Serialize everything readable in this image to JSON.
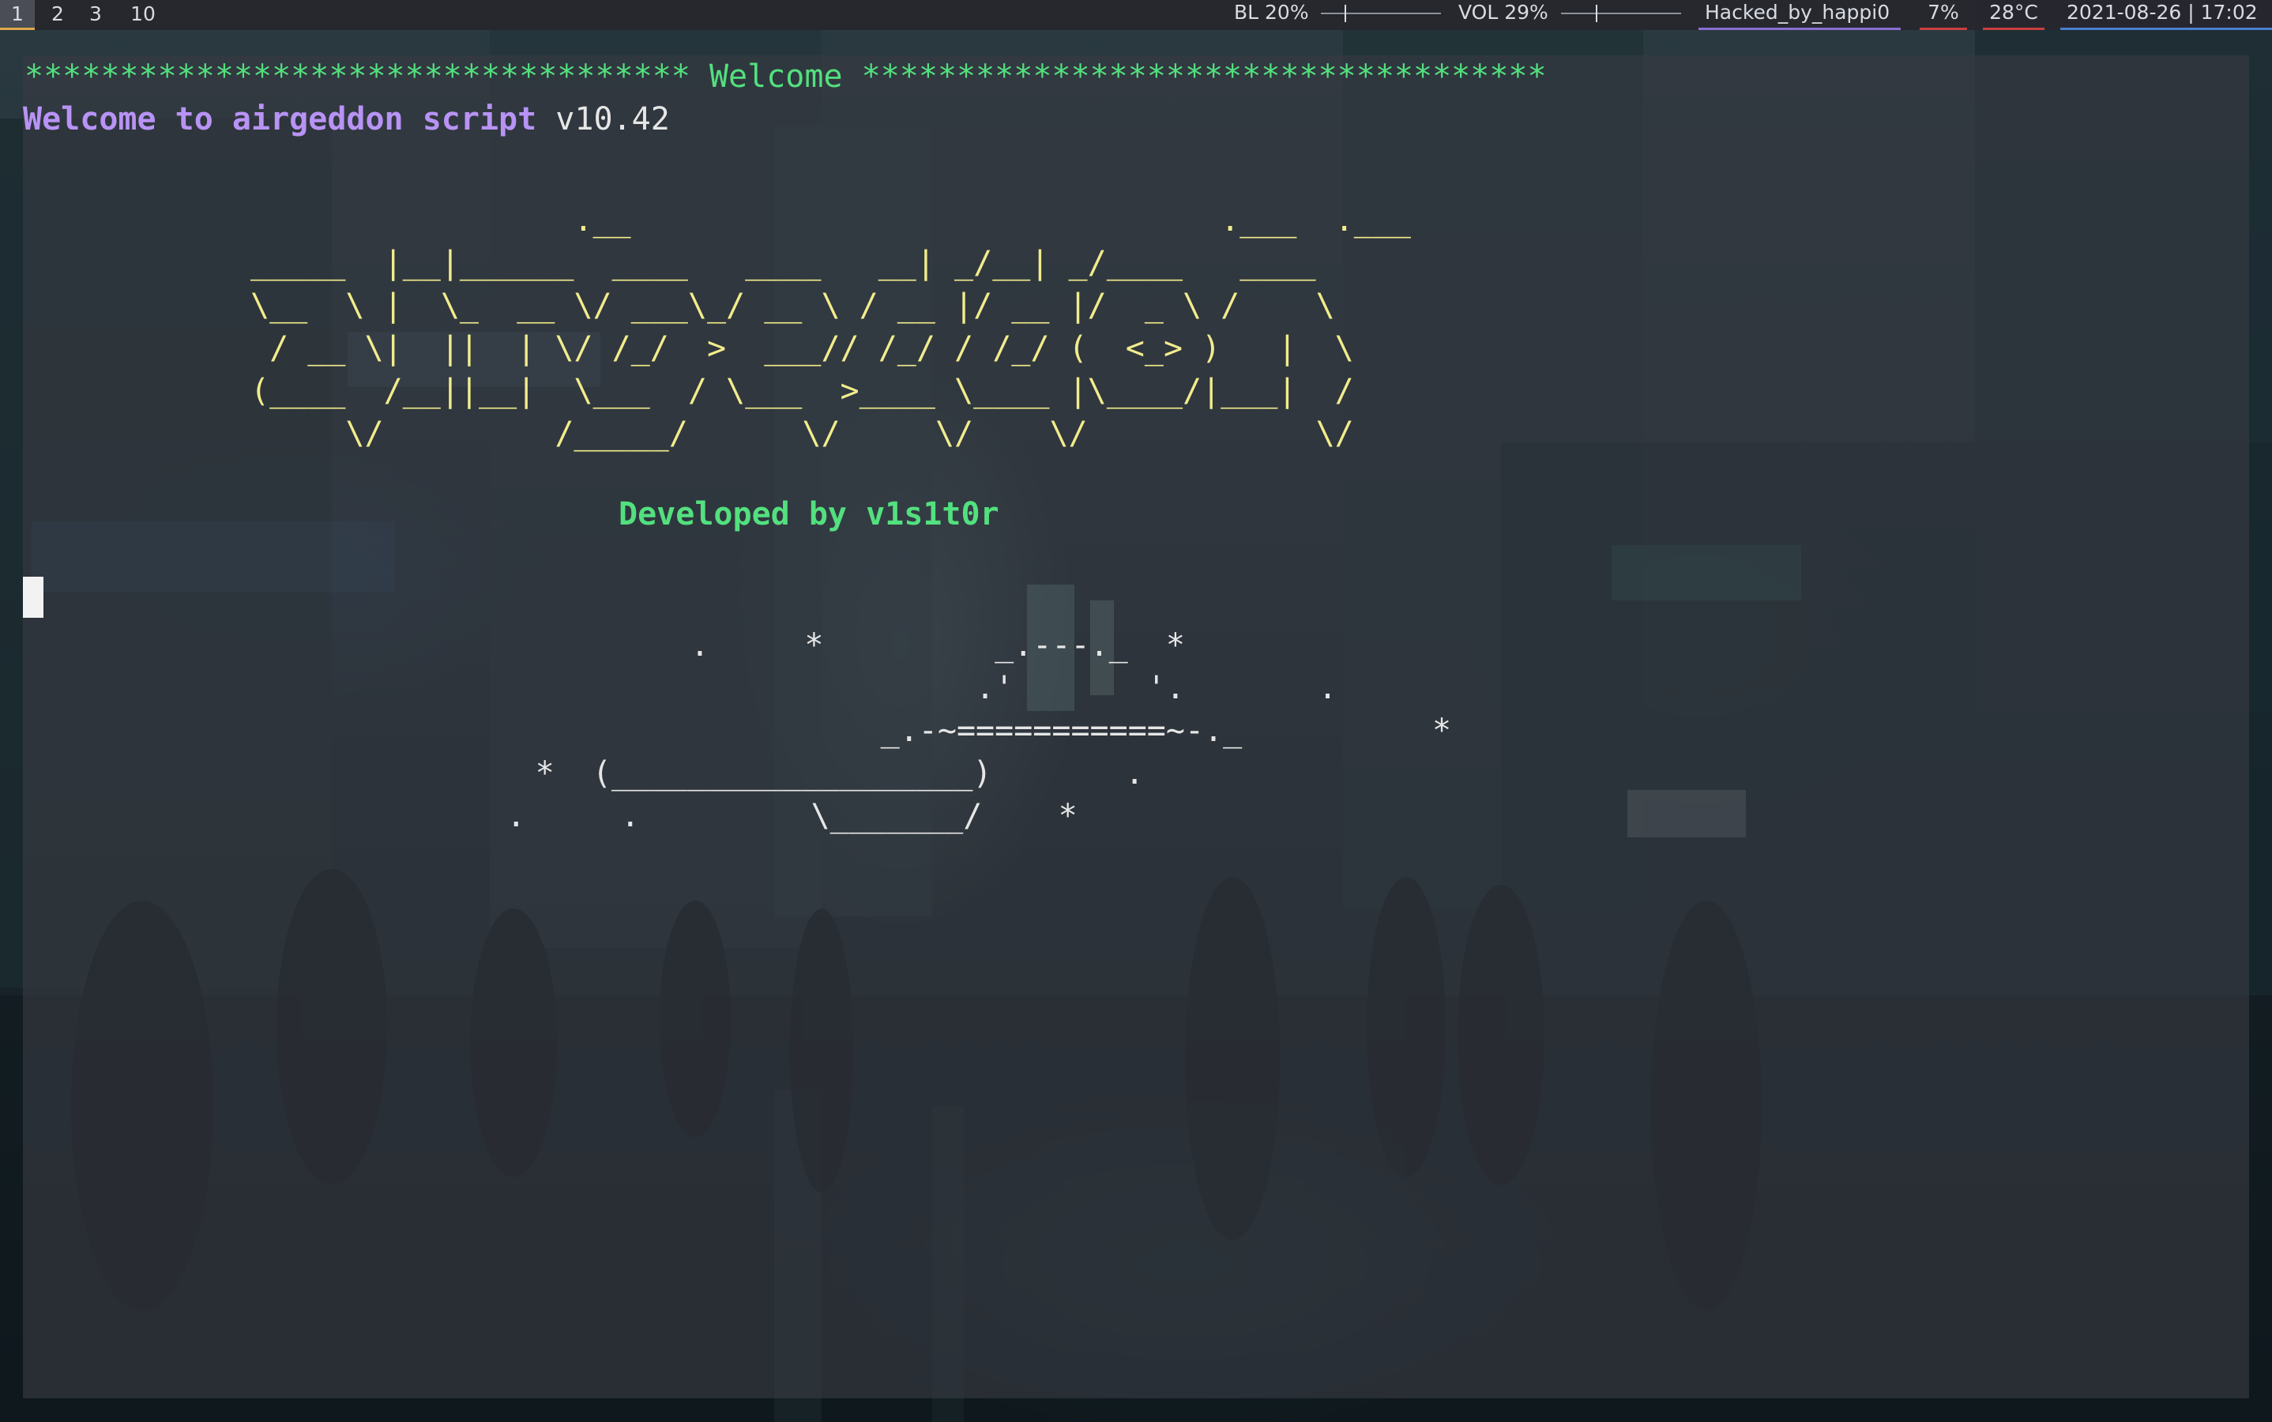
{
  "topbar": {
    "workspaces": [
      {
        "label": "1",
        "active": true
      },
      {
        "label": "2",
        "active": false
      },
      {
        "label": "3",
        "active": false
      },
      {
        "label": "10",
        "active": false
      }
    ],
    "backlight": {
      "label": "BL 20%",
      "level": 0.2
    },
    "volume": {
      "label": "VOL 29%",
      "level": 0.29
    },
    "hostname": "Hacked_by_happi0",
    "cpu": "7%",
    "temperature": "28°C",
    "datetime": "2021-08-26  | 17:02",
    "colors": {
      "active_workspace_underline": "#e0a94a",
      "hostname_underline": "#8a6fd1",
      "cpu_underline": "#c94040",
      "temperature_underline": "#c94040",
      "datetime_underline": "#4a7fd1"
    }
  },
  "terminal": {
    "welcome_banner": "*********************************** Welcome ************************************",
    "welcome_line_label": "Welcome to airgeddon script",
    "welcome_line_version": " v10.42",
    "logo_lines": [
      "                 .__                               .___  .___",
      "_____  |__|______  ____   ____   __| _/__| _/____   ____",
      "\\__  \\ |  \\_  __ \\/ ___\\_/ __ \\ / __ |/ __ |/  _ \\ /    \\",
      " / __ \\|  ||  | \\/ /_/  >  ___// /_/ / /_/ (  <_> )   |  \\",
      "(____  /__||__|  \\___  / \\___  >____ \\____ |\\____/|___|  /",
      "     \\/         /_____/      \\/     \\/    \\/            \\/"
    ],
    "developed_by": "Developed by v1s1t0r",
    "art_lines": [
      "          .     *         _.---._  *",
      "                         .'       '.       .",
      "                    _.-~===========~-._          *",
      "       *  (___________________)       .",
      "   .     .         \\_______/    *"
    ]
  },
  "icons": {
    "cursor": "terminal-block-cursor"
  }
}
